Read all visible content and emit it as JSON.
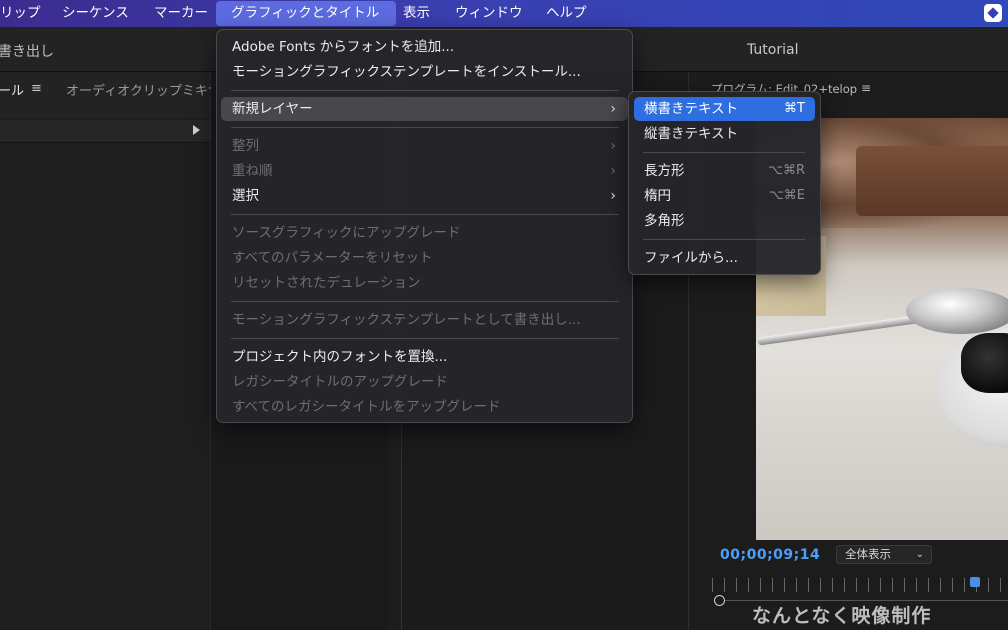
{
  "menubar": {
    "items": [
      "リップ",
      "シーケンス",
      "マーカー",
      "グラフィックとタイトル",
      "表示",
      "ウィンドウ",
      "ヘルプ"
    ],
    "active_index": 3,
    "colors": {
      "start": "#3c2c8f",
      "end": "#3048b8",
      "active": "#5c6be0"
    }
  },
  "workspace": {
    "title": "書き出し",
    "tutorial": "Tutorial"
  },
  "left_panel": {
    "tab_tool": "ール",
    "tab_menu_icon": "≡",
    "tab_mixer": "オーディオクリップミキサー"
  },
  "program": {
    "label": "プログラム: Edit_02+telop",
    "menu_icon": "≡",
    "timecode": "00;00;09;14",
    "fit_value": "全体表示",
    "timecode_color": "#4a9fff"
  },
  "watermark": "なんとなく映像制作",
  "menu": {
    "items": [
      {
        "label": "Adobe Fonts からフォントを追加...",
        "enabled": true
      },
      {
        "label": "モーショングラフィックステンプレートをインストール...",
        "enabled": true
      },
      {
        "label": "新規レイヤー",
        "enabled": true,
        "submenu": true,
        "highlighted": true
      },
      {
        "label": "整列",
        "enabled": false,
        "submenu": true
      },
      {
        "label": "重ね順",
        "enabled": false,
        "submenu": true
      },
      {
        "label": "選択",
        "enabled": true,
        "submenu": true
      },
      {
        "label": "ソースグラフィックにアップグレード",
        "enabled": false
      },
      {
        "label": "すべてのパラメーターをリセット",
        "enabled": false
      },
      {
        "label": "リセットされたデュレーション",
        "enabled": false
      },
      {
        "label": "モーショングラフィックステンプレートとして書き出し...",
        "enabled": false
      },
      {
        "label": "プロジェクト内のフォントを置換...",
        "enabled": true
      },
      {
        "label": "レガシータイトルのアップグレード",
        "enabled": false
      },
      {
        "label": "すべてのレガシータイトルをアップグレード",
        "enabled": false
      }
    ],
    "submenu_arrow": "›"
  },
  "submenu": {
    "items": [
      {
        "label": "横書きテキスト",
        "shortcut": "⌘T",
        "selected": true
      },
      {
        "label": "縦書きテキスト",
        "shortcut": ""
      },
      {
        "label": "長方形",
        "shortcut": "⌥⌘R"
      },
      {
        "label": "楕円",
        "shortcut": "⌥⌘E"
      },
      {
        "label": "多角形",
        "shortcut": ""
      },
      {
        "label": "ファイルから...",
        "shortcut": ""
      }
    ],
    "selected_color": "#2f6ee0"
  }
}
